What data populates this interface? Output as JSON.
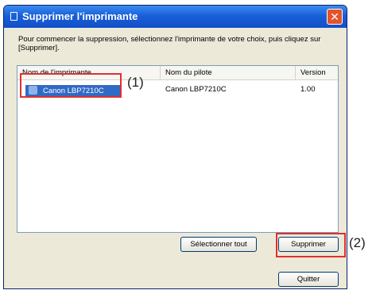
{
  "window": {
    "title": "Supprimer l'imprimante",
    "close_glyph": "✕"
  },
  "instruction": "Pour commencer la suppression, sélectionnez l'imprimante de votre choix, puis cliquez sur [Supprimer].",
  "list": {
    "columns": [
      "Nom de l'imprimante",
      "Nom du pilote",
      "Version"
    ],
    "rows": [
      {
        "printer": "Canon LBP7210C",
        "driver": "Canon LBP7210C",
        "version": "1.00",
        "icon": "printer-icon"
      }
    ]
  },
  "buttons": {
    "select_all": "Sélectionner tout",
    "delete": "Supprimer",
    "quit": "Quitter"
  },
  "annotations": {
    "marker_1": "(1)",
    "marker_2": "(2)",
    "highlight_color": "#e03030"
  }
}
